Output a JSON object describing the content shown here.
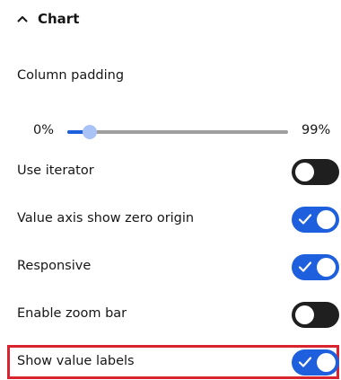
{
  "section": {
    "title": "Chart",
    "icon": "chevron-up-icon",
    "expanded": true
  },
  "column_padding": {
    "label": "Column padding",
    "min_label": "0%",
    "max_label": "99%",
    "value_percent": 10
  },
  "settings": [
    {
      "label": "Use iterator",
      "on": false
    },
    {
      "label": "Value axis show zero origin",
      "on": true
    },
    {
      "label": "Responsive",
      "on": true
    },
    {
      "label": "Enable zoom bar",
      "on": false
    },
    {
      "label": "Show value labels",
      "on": true,
      "highlighted": true
    }
  ],
  "colors": {
    "accent": "#1e5fde",
    "toggle_off": "#1f1f1f",
    "highlight_border": "#d9232e",
    "slider_thumb": "#a9c3f6",
    "slider_track": "#9e9e9e"
  }
}
